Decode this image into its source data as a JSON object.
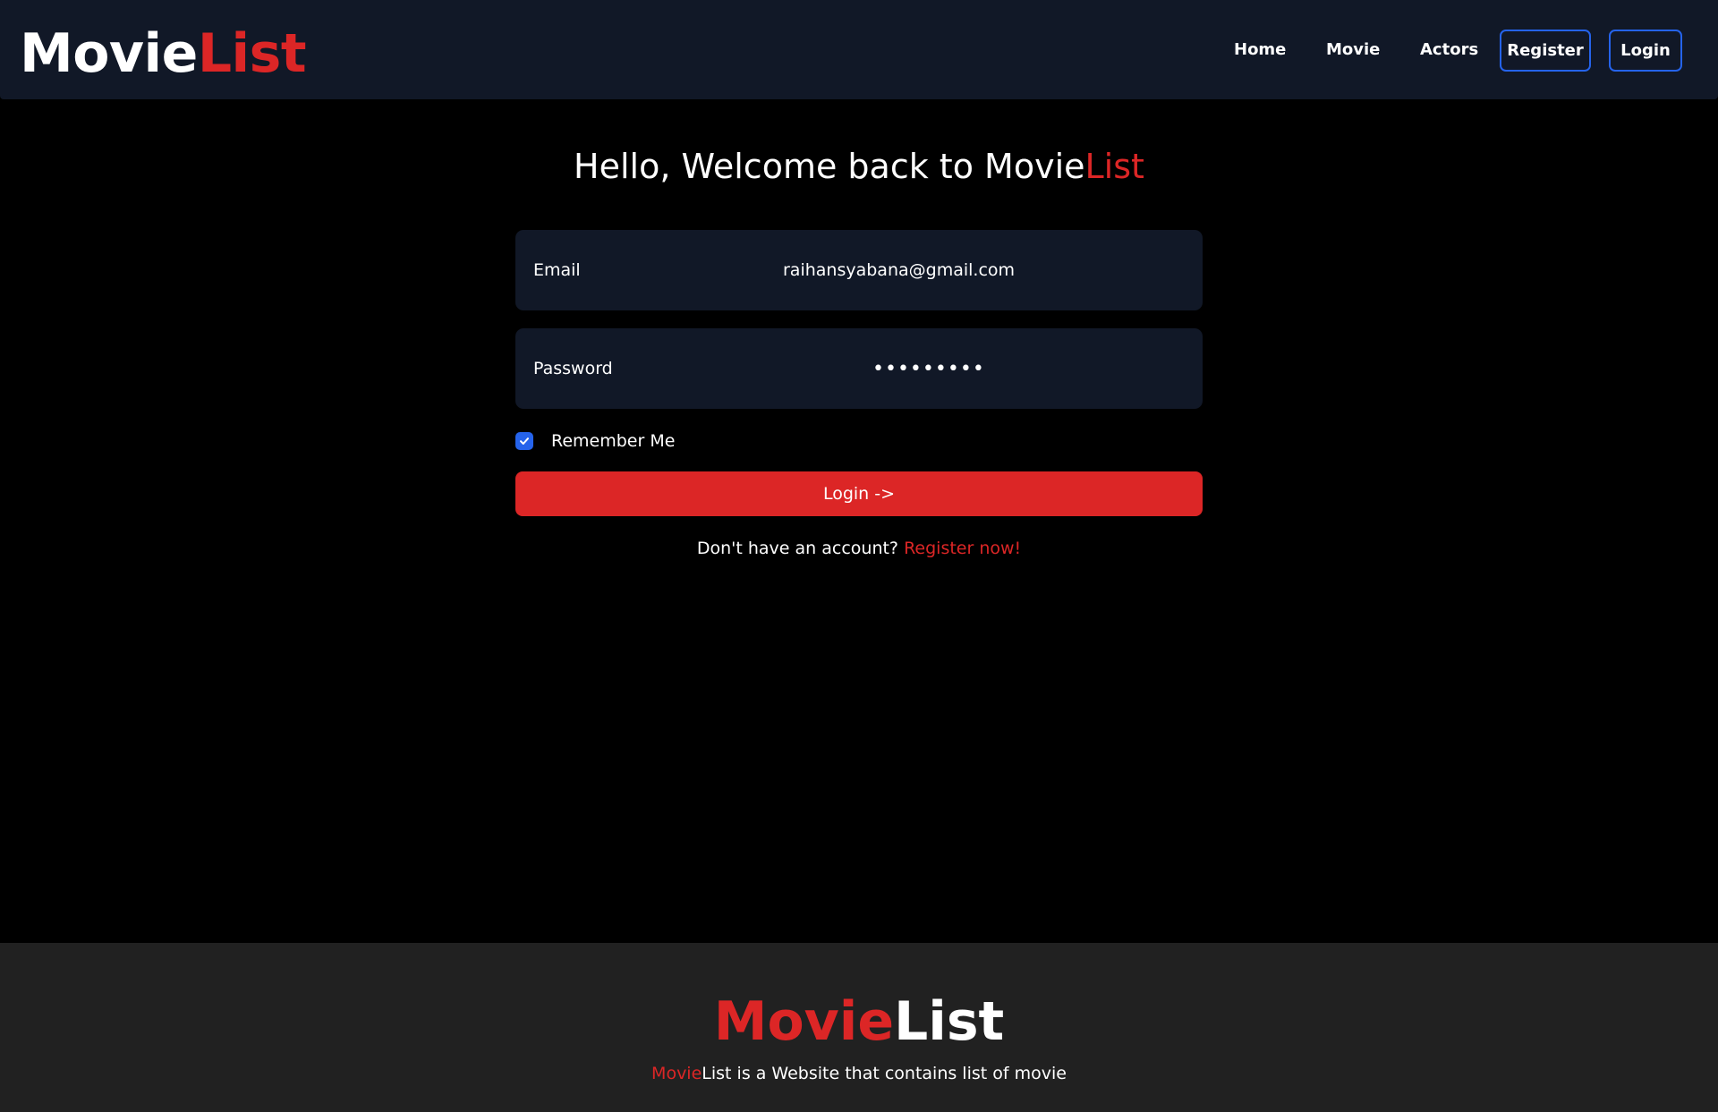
{
  "colors": {
    "accent_red": "#dc2626",
    "nav_bg": "#111827",
    "page_bg": "#000000",
    "footer_bg": "#212121",
    "button_border_blue": "#2563eb",
    "checkbox_blue": "#2563eb"
  },
  "header": {
    "brand_part1": "Movie",
    "brand_part2": "List",
    "nav": {
      "home": "Home",
      "movie": "Movie",
      "actors": "Actors",
      "register": "Register",
      "login": "Login"
    }
  },
  "main": {
    "title_prefix": "Hello, Welcome back to ",
    "title_brand_part1": "Movie",
    "title_brand_part2": "List",
    "email_label": "Email",
    "email_value": "raihansyabana@gmail.com",
    "password_label": "Password",
    "password_value": "•••••••••",
    "remember_label": "Remember Me",
    "remember_checked": true,
    "login_button": "Login ->",
    "signup_prompt": "Don't have an account? ",
    "signup_link": "Register now!"
  },
  "footer": {
    "brand_part1": "Movie",
    "brand_part2": "List",
    "desc_brand_part1": "Movie",
    "desc_rest": "List is a Website that contains list of movie"
  },
  "icons": {
    "checkbox": "check-icon"
  }
}
